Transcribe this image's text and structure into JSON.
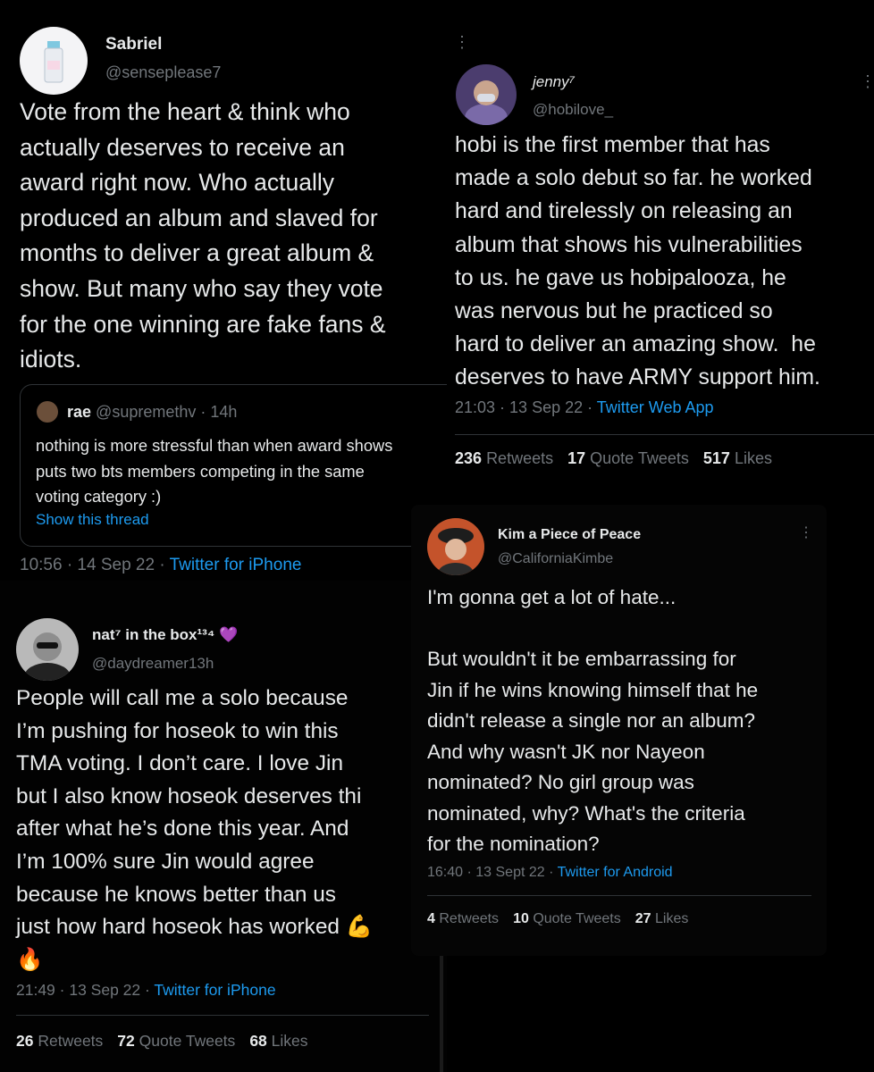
{
  "t1": {
    "name": "Sabriel",
    "handle": "@senseplease7",
    "text": "Vote from the heart & think who\nactually deserves to receive an\naward right now. Who actually\nproduced an album and slaved for\nmonths to deliver a great album &\nshow. But many who say they vote\nfor the one winning are fake fans &\nidiots.",
    "quote": {
      "name": "rae",
      "handle": "@supremethv",
      "sep": "·",
      "time": "14h",
      "text": "nothing is more stressful than when award shows\nputs two bts members competing in the same\nvoting category :)",
      "link": "Show this thread"
    },
    "date": "10:56 · 14 Sep 22 · ",
    "source": "Twitter for iPhone"
  },
  "t2": {
    "name": "jenny⁷",
    "handle": "@hobilove_",
    "text": "hobi is the first member that has\nmade a solo debut so far. he worked\nhard and tirelessly on releasing an\nalbum that shows his vulnerabilities\nto us. he gave us hobipalooza, he\nwas nervous but he practiced so\nhard to deliver an amazing show.  he\ndeserves to have ARMY support him.",
    "date": "21:03 · 13 Sep 22 · ",
    "source": "Twitter Web App",
    "retweets": "236",
    "retweets_label": "Retweets",
    "quotes": "17",
    "quotes_label": "Quote Tweets",
    "likes": "517",
    "likes_label": "Likes"
  },
  "t3": {
    "name": "nat⁷ in the box¹³⁴",
    "heart": "💜",
    "handle": "@daydreamer13h",
    "text": "People will call me a solo because\nI’m pushing for hoseok to win this\nTMA voting. I don’t care. I love Jin\nbut I also know hoseok deserves thi\nafter what he’s done this year. And\nI’m 100% sure Jin would agree\nbecause he knows better than us\njust how hard hoseok has worked 💪\n🔥",
    "date": "21:49 · 13 Sep 22 · ",
    "source": "Twitter for iPhone",
    "retweets": "26",
    "retweets_label": "Retweets",
    "quotes": "72",
    "quotes_label": "Quote Tweets",
    "likes": "68",
    "likes_label": "Likes"
  },
  "t4": {
    "name": "Kim a Piece of Peace",
    "handle": "@CaliforniaKimbe",
    "text": "I'm gonna get a lot of hate...\n\nBut wouldn't it be embarrassing for\nJin if he wins knowing himself that he\ndidn't release a single nor an album?\nAnd why wasn't JK nor Nayeon\nnominated? No girl group was\nnominated, why? What's the criteria\nfor the nomination?",
    "date": "16:40 · 13 Sept 22 · ",
    "source": "Twitter for Android",
    "retweets": "4",
    "retweets_label": "Retweets",
    "quotes": "10",
    "quotes_label": "Quote Tweets",
    "likes": "27",
    "likes_label": "Likes"
  },
  "colors": {
    "link": "#1d9bf0",
    "muted": "#71767b",
    "text": "#e7e9ea",
    "divider": "#2f3336"
  },
  "icons": [
    "more-options-icon",
    "avatar-image"
  ]
}
